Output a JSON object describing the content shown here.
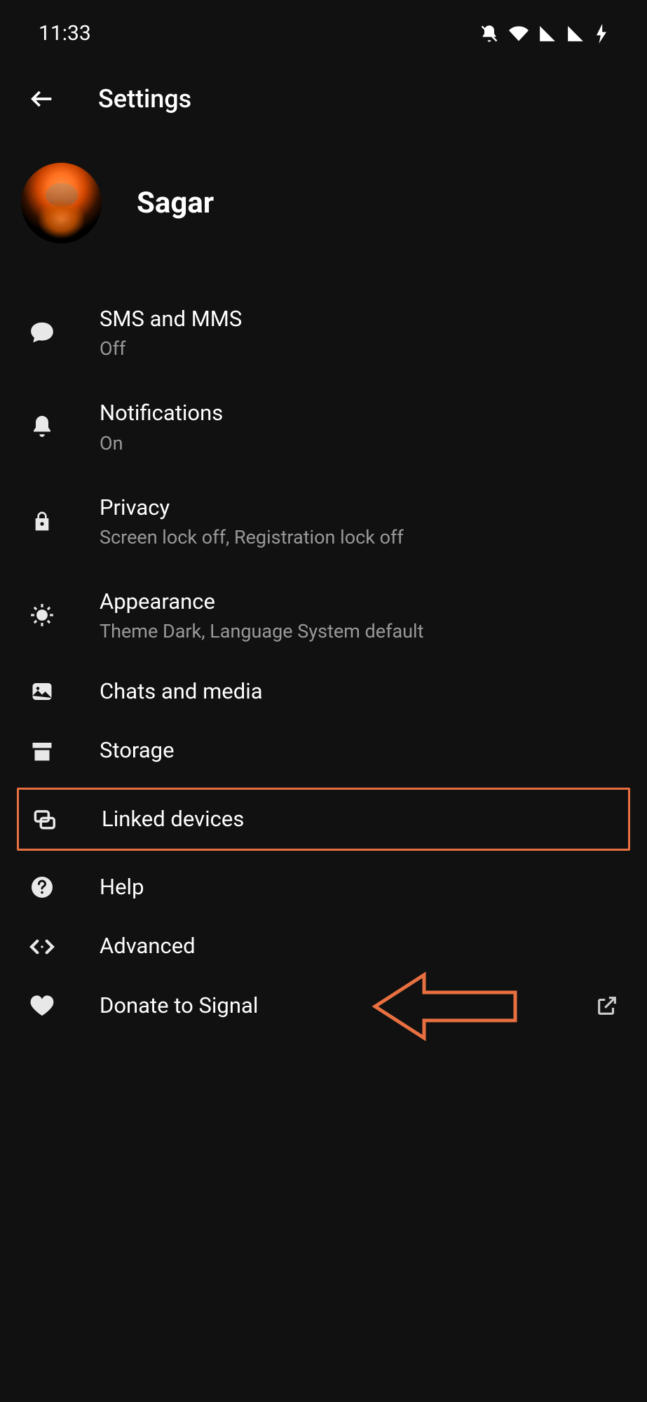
{
  "status_bar": {
    "time": "11:33"
  },
  "header": {
    "title": "Settings"
  },
  "profile": {
    "name": "Sagar"
  },
  "settings": {
    "sms": {
      "title": "SMS and MMS",
      "subtitle": "Off"
    },
    "notifications": {
      "title": "Notifications",
      "subtitle": "On"
    },
    "privacy": {
      "title": "Privacy",
      "subtitle": "Screen lock off, Registration lock off"
    },
    "appearance": {
      "title": "Appearance",
      "subtitle": "Theme Dark, Language System default"
    },
    "chats": {
      "title": "Chats and media"
    },
    "storage": {
      "title": "Storage"
    },
    "linked": {
      "title": "Linked devices"
    },
    "help": {
      "title": "Help"
    },
    "advanced": {
      "title": "Advanced"
    },
    "donate": {
      "title": "Donate to Signal"
    }
  }
}
